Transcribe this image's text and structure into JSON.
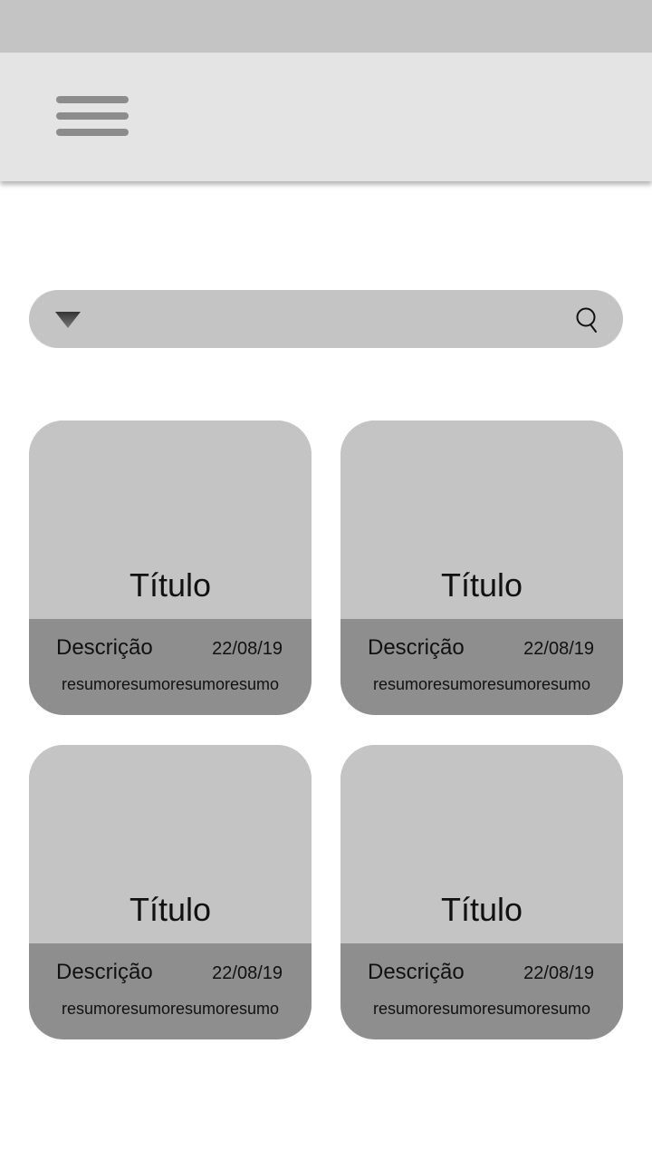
{
  "header": {
    "menu_icon": "hamburger-menu-icon"
  },
  "search": {
    "value": "",
    "placeholder": "",
    "dropdown_icon": "triangle-down-icon",
    "search_icon": "search-icon"
  },
  "cards": [
    {
      "title": "Título",
      "description": "Descrição",
      "date": "22/08/19",
      "summary": "resumoresumoresumoresumo"
    },
    {
      "title": "Título",
      "description": "Descrição",
      "date": "22/08/19",
      "summary": "resumoresumoresumoresumo"
    },
    {
      "title": "Título",
      "description": "Descrição",
      "date": "22/08/19",
      "summary": "resumoresumoresumoresumo"
    },
    {
      "title": "Título",
      "description": "Descrição",
      "date": "22/08/19",
      "summary": "resumoresumoresumoresumo"
    }
  ],
  "colors": {
    "status_bar": "#c4c4c4",
    "app_bar": "#e4e4e4",
    "card_top": "#c4c4c4",
    "card_footer": "#8f8e8e",
    "menu_lines": "#8c8c8c"
  }
}
